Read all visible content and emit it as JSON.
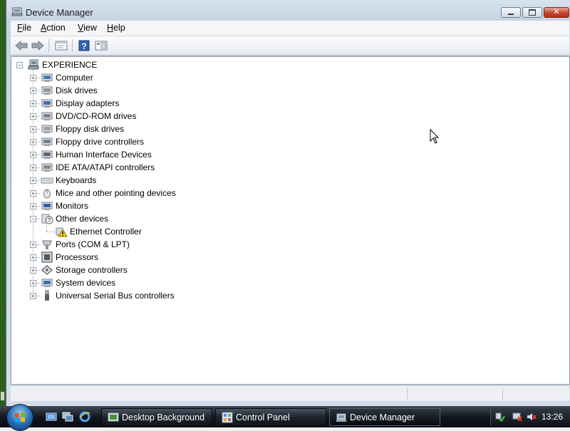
{
  "window": {
    "title": "Device Manager"
  },
  "menu": [
    {
      "pre": "",
      "key": "F",
      "rest": "ile"
    },
    {
      "pre": "",
      "key": "A",
      "rest": "ction"
    },
    {
      "pre": "",
      "key": "V",
      "rest": "iew"
    },
    {
      "pre": "",
      "key": "H",
      "rest": "elp"
    }
  ],
  "toolbar": {
    "icons": [
      "back-arrow-icon",
      "forward-arrow-icon",
      "properties-icon",
      "help-icon",
      "view-icon"
    ]
  },
  "tree": {
    "root": "EXPERIENCE",
    "nodes": [
      {
        "label": "Computer",
        "icon": "computer-icon",
        "expander": "+"
      },
      {
        "label": "Disk drives",
        "icon": "disk-drive-icon",
        "expander": "+"
      },
      {
        "label": "Display adapters",
        "icon": "display-adapter-icon",
        "expander": "+"
      },
      {
        "label": "DVD/CD-ROM drives",
        "icon": "dvd-drive-icon",
        "expander": "+"
      },
      {
        "label": "Floppy disk drives",
        "icon": "floppy-drive-icon",
        "expander": "+"
      },
      {
        "label": "Floppy drive controllers",
        "icon": "floppy-controller-icon",
        "expander": "+"
      },
      {
        "label": "Human Interface Devices",
        "icon": "hid-icon",
        "expander": "+"
      },
      {
        "label": "IDE ATA/ATAPI controllers",
        "icon": "ide-controller-icon",
        "expander": "+"
      },
      {
        "label": "Keyboards",
        "icon": "keyboard-icon",
        "expander": "+"
      },
      {
        "label": "Mice and other pointing devices",
        "icon": "mouse-icon",
        "expander": "+"
      },
      {
        "label": "Monitors",
        "icon": "monitor-icon",
        "expander": "+"
      },
      {
        "label": "Other devices",
        "icon": "other-devices-icon",
        "expander": "-"
      },
      {
        "label": "Ethernet Controller",
        "icon": "warning-device-icon",
        "expander": "",
        "child": true
      },
      {
        "label": "Ports (COM & LPT)",
        "icon": "port-icon",
        "expander": "+"
      },
      {
        "label": "Processors",
        "icon": "processor-icon",
        "expander": "+"
      },
      {
        "label": "Storage controllers",
        "icon": "storage-controller-icon",
        "expander": "+"
      },
      {
        "label": "System devices",
        "icon": "system-devices-icon",
        "expander": "+"
      },
      {
        "label": "Universal Serial Bus controllers",
        "icon": "usb-icon",
        "expander": "+"
      }
    ]
  },
  "taskbar": {
    "quick_launch": [
      "show-desktop-icon",
      "switch-windows-icon",
      "internet-explorer-icon"
    ],
    "tasks": [
      {
        "label": "Desktop Background",
        "icon": "desktop-background-icon"
      },
      {
        "label": "Control Panel",
        "icon": "control-panel-icon"
      },
      {
        "label": "Device Manager",
        "icon": "device-manager-icon",
        "active": true
      }
    ],
    "clock": "13:26"
  },
  "colors": {
    "accent": "#2b6fb7",
    "warning": "#f5d000"
  }
}
